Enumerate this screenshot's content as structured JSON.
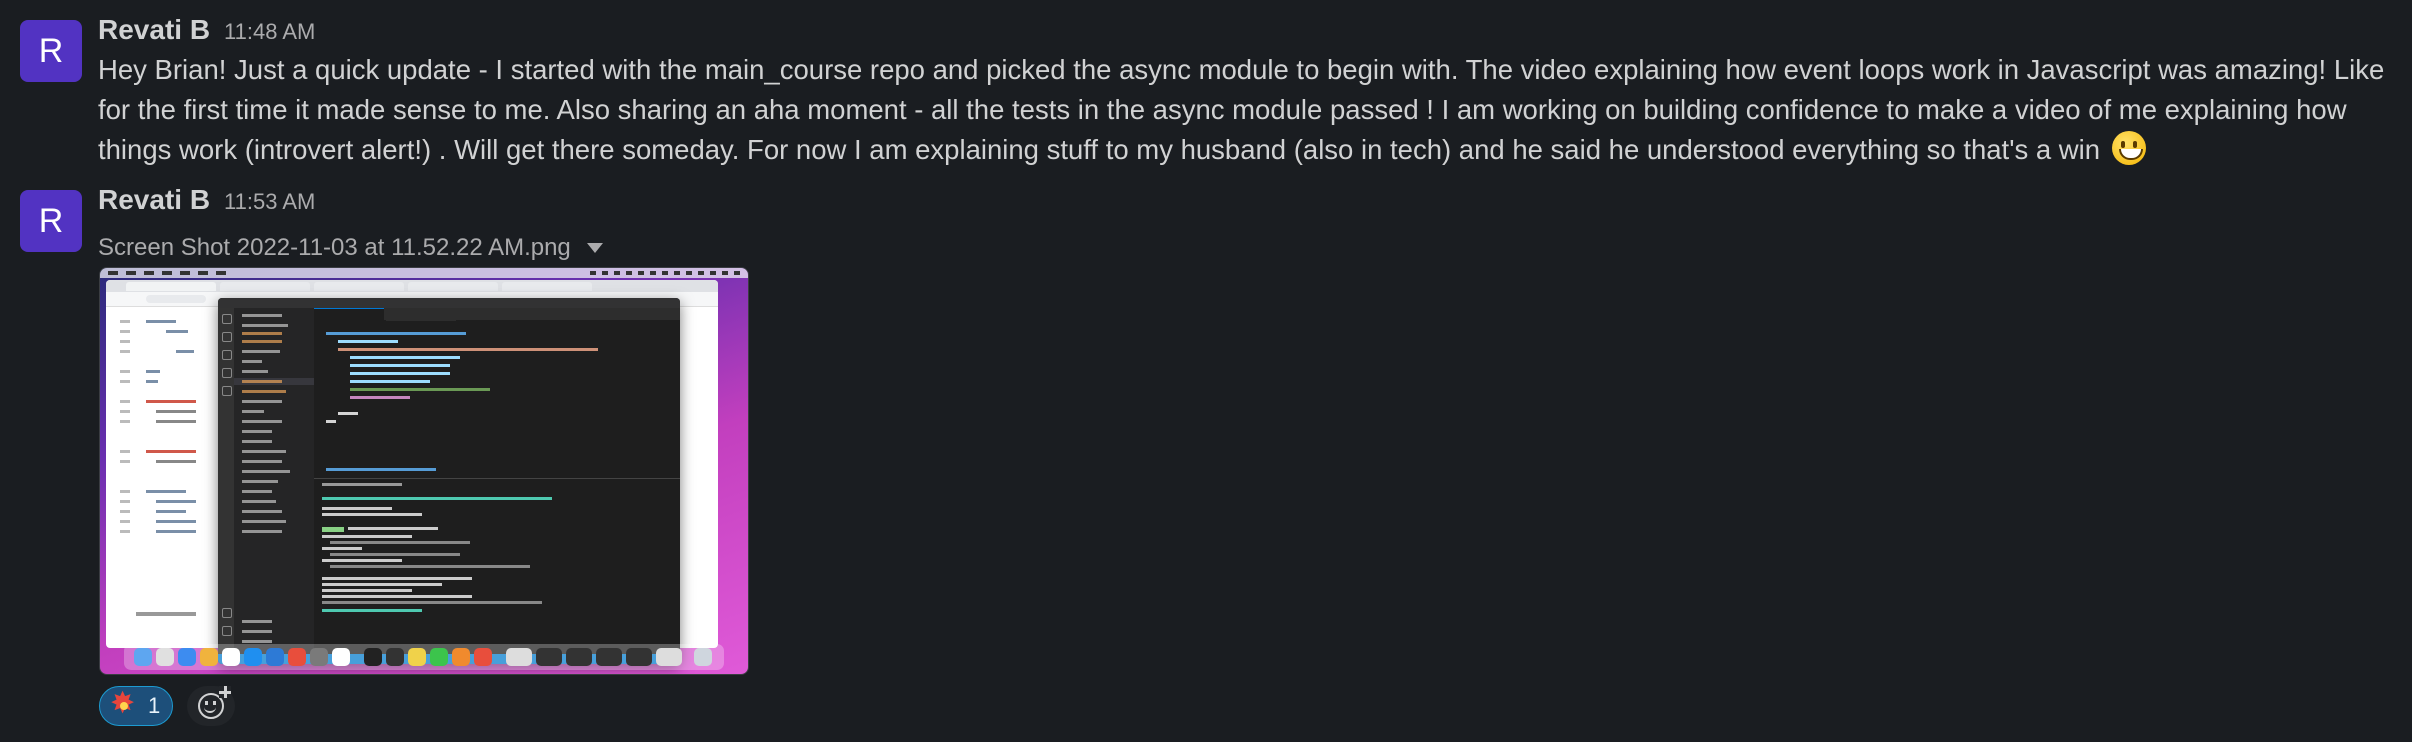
{
  "messages": [
    {
      "avatar_initial": "R",
      "author": "Revati B",
      "time": "11:48 AM",
      "text": "Hey Brian! Just a quick update - I started with the main_course repo and picked the async module to begin with. The video explaining how event loops work in Javascript was amazing! Like for the first time it made sense to me. Also sharing an aha moment - all the tests in the async module passed ! I am working on building confidence to make a video of me explaining how things work (introvert alert!) . Will get there someday. For now I am explaining stuff to my husband (also in tech) and he said he understood everything so that's a win",
      "trailing_emoji": "grinning-face-emoji"
    },
    {
      "avatar_initial": "R",
      "author": "Revati B",
      "time": "11:53 AM",
      "attachment": {
        "filename": "Screen Shot 2022-11-03 at 11.52.22 AM.png",
        "icon": "chevron-down-icon"
      }
    }
  ],
  "reactions": [
    {
      "icon": "collision-emoji",
      "count": "1",
      "color": "#1d9bd1"
    }
  ],
  "add_reaction_icon": "add-reaction-icon",
  "colors": {
    "background": "#1a1d21",
    "avatar": "#5233c2",
    "text": "#d1d2d3",
    "muted": "#ababad"
  }
}
